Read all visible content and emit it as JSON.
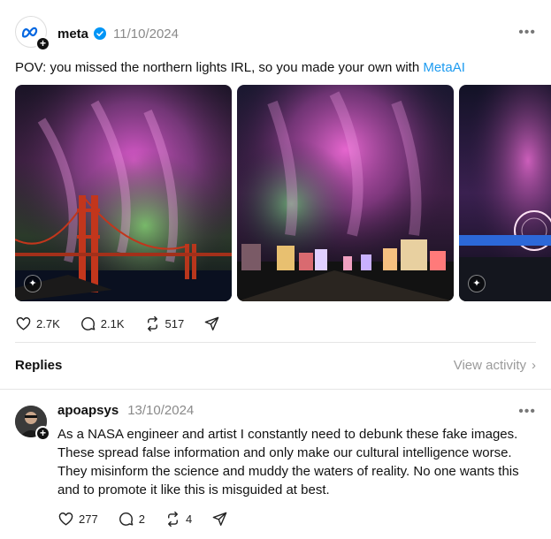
{
  "post": {
    "username": "meta",
    "date": "11/10/2024",
    "caption_text": "POV: you missed the northern lights IRL, so you made your own with ",
    "caption_link": "MetaAI",
    "images": [
      {
        "subject": "Aurora over golden gate bridge"
      },
      {
        "subject": "Aurora over city skyline"
      },
      {
        "subject": "Aurora over ferris wheel"
      }
    ],
    "actions": {
      "likes": "2.7K",
      "comments": "2.1K",
      "reposts": "517"
    }
  },
  "replies_section": {
    "title": "Replies",
    "view_activity": "View activity"
  },
  "reply": {
    "username": "apoapsys",
    "date": "13/10/2024",
    "text": "As a NASA engineer and artist I constantly need to debunk these fake images. These spread false information and only make our cultural intelligence worse. They misinform the science and muddy the waters of reality. No one wants this and to promote it like this is misguided at best.",
    "actions": {
      "likes": "277",
      "comments": "2",
      "reposts": "4"
    }
  },
  "colors": {
    "link": "#1d9bf0",
    "verified": "#0095f6",
    "muted": "#8a8a8a"
  }
}
